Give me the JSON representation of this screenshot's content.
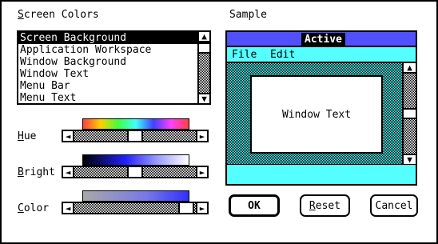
{
  "screen_colors": {
    "label_prefix": "",
    "label_mnemonic": "S",
    "label_rest": "creen Colors",
    "items": [
      "Screen Background",
      "Application Workspace",
      "Window Background",
      "Window Text",
      "Menu Bar",
      "Menu Text"
    ],
    "selected_index": 0
  },
  "sample": {
    "label": "Sample",
    "caption": "Active",
    "menu": [
      "File",
      "Edit"
    ],
    "window_text": "Window Text"
  },
  "hue": {
    "label_mnemonic": "H",
    "label_rest": "ue",
    "level": 0.43
  },
  "bright": {
    "label_mnemonic": "B",
    "label_rest": "right",
    "level": 0.43
  },
  "color": {
    "label_mnemonic": "C",
    "label_rest": "olor",
    "level": 0.78
  },
  "buttons": {
    "ok": "OK",
    "reset_mnemonic": "R",
    "reset_rest": "eset",
    "cancel": "Cancel"
  },
  "icons": {
    "up": "▲",
    "down": "▼",
    "left": "◄",
    "right": "►"
  },
  "colors": {
    "caption": "#5050ff",
    "menu_bar": "#55ffff",
    "selection": "#000000"
  }
}
